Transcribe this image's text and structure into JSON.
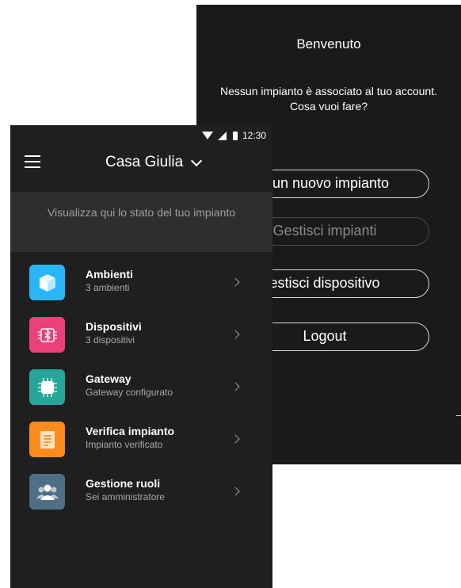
{
  "welcome": {
    "title": "Benvenuto",
    "message_line1": "Nessun impianto è associato al tuo account.",
    "message_line2": "Cosa vuoi fare?",
    "buttons": [
      {
        "label": "a un nuovo impianto",
        "enabled": true
      },
      {
        "label": "Gestisci impianti",
        "enabled": false
      },
      {
        "label": "estisci dispositivo",
        "enabled": true
      },
      {
        "label": "Logout",
        "enabled": true
      }
    ]
  },
  "status_bar": {
    "time": "12:30",
    "icons": [
      "wifi-icon",
      "signal-icon",
      "battery-icon"
    ]
  },
  "app_bar": {
    "title": "Casa Giulia",
    "menu_icon": "hamburger-icon",
    "dropdown_icon": "chevron-down-icon"
  },
  "summary": {
    "text": "Visualizza qui lo stato del tuo impianto"
  },
  "menu": [
    {
      "label": "Ambienti",
      "sub": "3 ambienti",
      "icon": "cube-icon",
      "color": "#29b6f6"
    },
    {
      "label": "Dispositivi",
      "sub": "3 dispositivi",
      "icon": "bluetooth-chip-icon",
      "color": "#ec407a"
    },
    {
      "label": "Gateway",
      "sub": "Gateway configurato",
      "icon": "gateway-chip-icon",
      "color": "#26a69a"
    },
    {
      "label": "Verifica impianto",
      "sub": "Impianto verificato",
      "icon": "document-check-icon",
      "color": "#ff8a1c"
    },
    {
      "label": "Gestione ruoli",
      "sub": "Sei amministratore",
      "icon": "users-icon",
      "color": "#4f6f84"
    }
  ]
}
